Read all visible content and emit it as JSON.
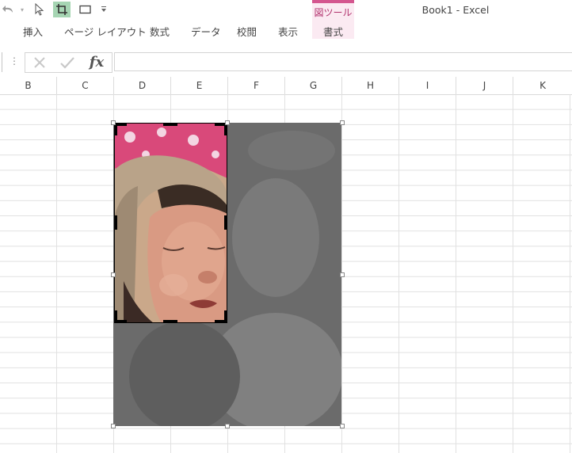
{
  "window": {
    "title": "Book1 - Excel"
  },
  "quick_access": {
    "undo_icon": "undo-icon",
    "select_icon": "select-objects-icon",
    "crop_icon": "crop-icon",
    "shape_icon": "rectangle-shape-icon",
    "customize_icon": "customize-toolbar-icon"
  },
  "contextual_tab": {
    "label": "図ツール",
    "color": "#d4568f"
  },
  "ribbon": {
    "tabs": [
      "挿入",
      "ページ レイアウト",
      "数式",
      "データ",
      "校閲",
      "表示",
      "書式"
    ],
    "active_tab": "書式"
  },
  "formula_bar": {
    "fx_label": "fx",
    "value": ""
  },
  "columns": [
    "B",
    "C",
    "D",
    "E",
    "F",
    "G",
    "H",
    "I",
    "J",
    "K"
  ],
  "picture": {
    "description_icon": "cropped-photo",
    "crop_mode": true
  }
}
